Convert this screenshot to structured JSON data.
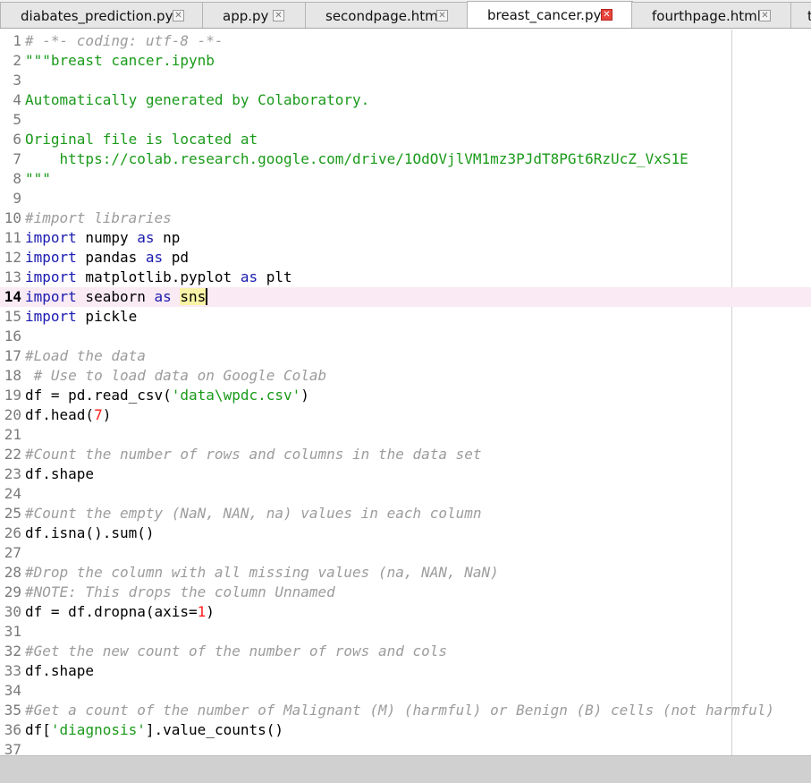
{
  "tabs": [
    {
      "label": "diabates_prediction.py",
      "active": false
    },
    {
      "label": "app.py",
      "active": false
    },
    {
      "label": "secondpage.html",
      "active": false
    },
    {
      "label": "breast_cancer.py",
      "active": true
    },
    {
      "label": "fourthpage.html",
      "active": false
    },
    {
      "label": "t",
      "active": false
    }
  ],
  "tab_close_glyph": "✕",
  "editor": {
    "current_line": 14,
    "colors": {
      "comment": "#9c9c9c",
      "string": "#1a9a1a",
      "keyword": "#1a1ab0",
      "number": "#ff1a1a",
      "current_line_bg": "#f9eaf4",
      "match_highlight": "#f8f3a6"
    },
    "lines": [
      {
        "n": "1",
        "segs": [
          {
            "t": "# -*- coding: utf-8 -*-",
            "c": "comment"
          }
        ]
      },
      {
        "n": "2",
        "segs": [
          {
            "t": "\"\"\"breast cancer.ipynb",
            "c": "string"
          }
        ]
      },
      {
        "n": "3",
        "segs": []
      },
      {
        "n": "4",
        "segs": [
          {
            "t": "Automatically generated by Colaboratory.",
            "c": "string"
          }
        ]
      },
      {
        "n": "5",
        "segs": []
      },
      {
        "n": "6",
        "segs": [
          {
            "t": "Original file is located at",
            "c": "string"
          }
        ]
      },
      {
        "n": "7",
        "segs": [
          {
            "t": "    https://colab.research.google.com/drive/1OdOVjlVM1mz3PJdT8PGt6RzUcZ_VxS1E",
            "c": "string"
          }
        ]
      },
      {
        "n": "8",
        "segs": [
          {
            "t": "\"\"\"",
            "c": "string"
          }
        ]
      },
      {
        "n": "9",
        "segs": []
      },
      {
        "n": "10",
        "segs": [
          {
            "t": "#import libraries",
            "c": "comment"
          }
        ]
      },
      {
        "n": "11",
        "segs": [
          {
            "t": "import",
            "c": "keyword"
          },
          {
            "t": " numpy ",
            "c": "plain"
          },
          {
            "t": "as",
            "c": "keyword"
          },
          {
            "t": " np",
            "c": "plain"
          }
        ]
      },
      {
        "n": "12",
        "segs": [
          {
            "t": "import",
            "c": "keyword"
          },
          {
            "t": " pandas ",
            "c": "plain"
          },
          {
            "t": "as",
            "c": "keyword"
          },
          {
            "t": " pd",
            "c": "plain"
          }
        ]
      },
      {
        "n": "13",
        "segs": [
          {
            "t": "import",
            "c": "keyword"
          },
          {
            "t": " matplotlib.pyplot ",
            "c": "plain"
          },
          {
            "t": "as",
            "c": "keyword"
          },
          {
            "t": " plt",
            "c": "plain"
          }
        ]
      },
      {
        "n": "14",
        "segs": [
          {
            "t": "import",
            "c": "keyword"
          },
          {
            "t": " seaborn ",
            "c": "plain"
          },
          {
            "t": "as",
            "c": "keyword"
          },
          {
            "t": " ",
            "c": "plain"
          },
          {
            "t": "sns",
            "c": "hl"
          },
          {
            "t": "",
            "c": "caret"
          }
        ]
      },
      {
        "n": "15",
        "segs": [
          {
            "t": "import",
            "c": "keyword"
          },
          {
            "t": " pickle",
            "c": "plain"
          }
        ]
      },
      {
        "n": "16",
        "segs": []
      },
      {
        "n": "17",
        "segs": [
          {
            "t": "#Load the data",
            "c": "comment"
          }
        ]
      },
      {
        "n": "18",
        "segs": [
          {
            "t": " # Use to load data on Google Colab",
            "c": "comment"
          }
        ]
      },
      {
        "n": "19",
        "segs": [
          {
            "t": "df = pd.read_csv(",
            "c": "plain"
          },
          {
            "t": "'data\\wpdc.csv'",
            "c": "string"
          },
          {
            "t": ")",
            "c": "plain"
          }
        ]
      },
      {
        "n": "20",
        "segs": [
          {
            "t": "df.head(",
            "c": "plain"
          },
          {
            "t": "7",
            "c": "number"
          },
          {
            "t": ")",
            "c": "plain"
          }
        ]
      },
      {
        "n": "21",
        "segs": []
      },
      {
        "n": "22",
        "segs": [
          {
            "t": "#Count the number of rows and columns in the data set",
            "c": "comment"
          }
        ]
      },
      {
        "n": "23",
        "segs": [
          {
            "t": "df.shape",
            "c": "plain"
          }
        ]
      },
      {
        "n": "24",
        "segs": []
      },
      {
        "n": "25",
        "segs": [
          {
            "t": "#Count the empty (NaN, NAN, na) values in each column",
            "c": "comment"
          }
        ]
      },
      {
        "n": "26",
        "segs": [
          {
            "t": "df.isna().sum()",
            "c": "plain"
          }
        ]
      },
      {
        "n": "27",
        "segs": []
      },
      {
        "n": "28",
        "segs": [
          {
            "t": "#Drop the column with all missing values (na, NAN, NaN)",
            "c": "comment"
          }
        ]
      },
      {
        "n": "29",
        "segs": [
          {
            "t": "#NOTE: This drops the column Unnamed",
            "c": "comment"
          }
        ]
      },
      {
        "n": "30",
        "segs": [
          {
            "t": "df = df.dropna(axis=",
            "c": "plain"
          },
          {
            "t": "1",
            "c": "number"
          },
          {
            "t": ")",
            "c": "plain"
          }
        ]
      },
      {
        "n": "31",
        "segs": []
      },
      {
        "n": "32",
        "segs": [
          {
            "t": "#Get the new count of the number of rows and cols",
            "c": "comment"
          }
        ]
      },
      {
        "n": "33",
        "segs": [
          {
            "t": "df.shape",
            "c": "plain"
          }
        ]
      },
      {
        "n": "34",
        "segs": []
      },
      {
        "n": "35",
        "segs": [
          {
            "t": "#Get a count of the number of Malignant (M) (harmful) or Benign (B) cells (not harmful)",
            "c": "comment"
          }
        ]
      },
      {
        "n": "36",
        "segs": [
          {
            "t": "df[",
            "c": "plain"
          },
          {
            "t": "'diagnosis'",
            "c": "string"
          },
          {
            "t": "].value_counts()",
            "c": "plain"
          }
        ]
      },
      {
        "n": "37",
        "segs": []
      }
    ]
  }
}
